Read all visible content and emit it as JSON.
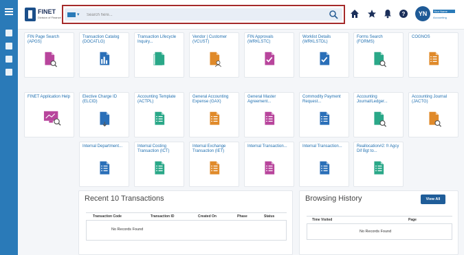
{
  "header": {
    "logo_title": "FINET",
    "logo_subtitle": "Division of Finance",
    "search_placeholder": "Search here...",
    "user_initials": "YN",
    "user_name": "Your Name",
    "user_role": "Accounting"
  },
  "tiles": [
    {
      "label": "FIN Page Search (APGS)",
      "icon": "search-doc-icon",
      "color": "#b8459c"
    },
    {
      "label": "Transaction Catalog (DOCATLG)",
      "icon": "catalog-chart-icon",
      "color": "#2a6fb8"
    },
    {
      "label": "Transaction Lifecycle Inquiry...",
      "icon": "stacked-docs-icon",
      "color": "#2aa888"
    },
    {
      "label": "Vendor | Customer (VCUST)",
      "icon": "person-doc-icon",
      "color": "#e08a2a"
    },
    {
      "label": "FIN Approvals (WRKLSTC)",
      "icon": "check-doc-icon",
      "color": "#b8459c"
    },
    {
      "label": "Worklist Details (WRKLSTDL)",
      "icon": "check-doc-icon",
      "color": "#2a6fb8"
    },
    {
      "label": "Forms Search (FORMS)",
      "icon": "search-doc-icon",
      "color": "#2aa888"
    },
    {
      "label": "COGNOS",
      "icon": "list-doc-icon",
      "color": "#e08a2a"
    },
    {
      "label": "FINET Application Help",
      "icon": "help-monitor-icon",
      "color": "#b8459c"
    },
    {
      "label": "Elective Charge ID (ELCID)",
      "icon": "doc-down-arrow-icon",
      "color": "#2a6fb8"
    },
    {
      "label": "Accounting Template (ACTPL)",
      "icon": "list-doc-icon",
      "color": "#2aa888"
    },
    {
      "label": "General Accounting Expense (GAX)",
      "icon": "list-doc-icon",
      "color": "#e08a2a"
    },
    {
      "label": "General Master Agreement...",
      "icon": "list-doc-icon",
      "color": "#b8459c"
    },
    {
      "label": "Commodity Payment Request...",
      "icon": "list-doc-icon",
      "color": "#2a6fb8"
    },
    {
      "label": "Accounting Journal/Ledger...",
      "icon": "search-doc-icon",
      "color": "#2aa888"
    },
    {
      "label": "Accounting Journal (JACTG)",
      "icon": "search-doc-icon",
      "color": "#e08a2a"
    },
    {
      "label": "Internal Department...",
      "icon": "list-doc-icon",
      "color": "#2a6fb8"
    },
    {
      "label": "Internal Costing Transaction (ICT)",
      "icon": "list-doc-icon",
      "color": "#2aa888"
    },
    {
      "label": "Internal Exchange Transaction (IET)",
      "icon": "list-doc-icon",
      "color": "#e08a2a"
    },
    {
      "label": "Internal Transaction...",
      "icon": "list-doc-icon",
      "color": "#b8459c"
    },
    {
      "label": "Internal Transaction...",
      "icon": "list-doc-icon",
      "color": "#2a6fb8"
    },
    {
      "label": "Reallocation#2: fr Agcy Dif Bgt to...",
      "icon": "list-doc-icon",
      "color": "#2aa888"
    }
  ],
  "recent": {
    "title": "Recent 10 Transactions",
    "columns": [
      "Transaction Code",
      "Transaction ID",
      "Created On",
      "Phase",
      "Status"
    ],
    "empty_text": "No Records Found"
  },
  "history": {
    "title": "Browsing History",
    "view_all": "View All",
    "columns": [
      "Time Visited",
      "Page"
    ],
    "empty_text": "No Records Found"
  },
  "colors": {
    "sidebar": "#2a7ab8",
    "accent": "#1f6fb0",
    "highlight_border": "#a52a2a"
  }
}
